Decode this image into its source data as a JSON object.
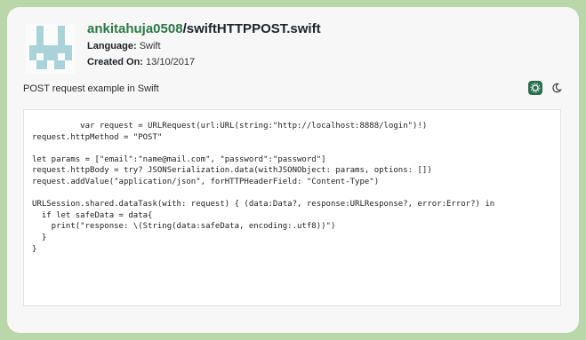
{
  "gist": {
    "username": "ankitahuja0508",
    "separator": "/",
    "filename": "swiftHTTPPOST.swift",
    "language_label": "Language:",
    "language_value": "Swift",
    "created_label": "Created On:",
    "created_value": "13/10/2017",
    "description": "POST request example in Swift"
  },
  "toolbar": {
    "light_theme_icon": "sun-icon",
    "dark_theme_icon": "moon-icon",
    "accent_color": "#2a6f4c"
  },
  "code": {
    "language": "swift",
    "lines": [
      "          var request = URLRequest(url:URL(string:\"http://localhost:8888/login\")!)",
      "request.httpMethod = \"POST\"",
      "",
      "let params = [\"email\":\"name@mail.com\", \"password\":\"password\"]",
      "request.httpBody = try? JSONSerialization.data(withJSONObject: params, options: [])",
      "request.addValue(\"application/json\", forHTTPHeaderField: \"Content-Type\")",
      "",
      "URLSession.shared.dataTask(with: request) { (data:Data?, response:URLResponse?, error:Error?) in",
      "  if let safeData = data{",
      "    print(\"response: \\(String(data:safeData, encoding:.utf8))\")",
      "  }",
      "}"
    ]
  }
}
